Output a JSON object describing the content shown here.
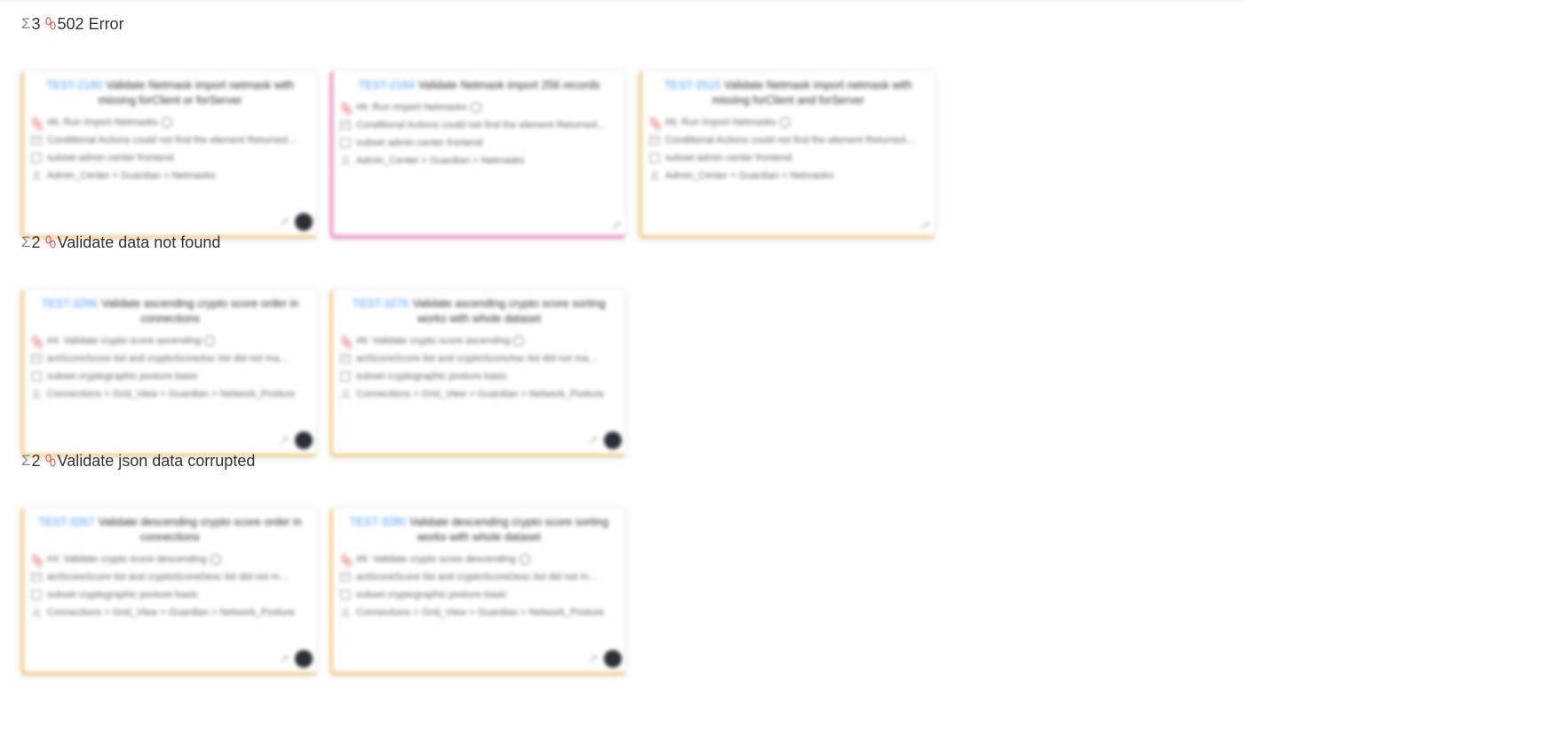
{
  "groups": [
    {
      "count": "3",
      "name": "502 Error",
      "cards": [
        {
          "id": "TEST-2180",
          "title": "Validate Netmask import netmask with missing forClient or forServer",
          "step": "#6: Run Import Netmasks",
          "error": "Conditional Actions could not find the element Returned…",
          "subset": "subset admin center frontend",
          "path": "Admin_Center > Guardian > Netmasks",
          "status": "failed",
          "github": true
        },
        {
          "id": "TEST-2184",
          "title": "Validate Netmask import 256 records",
          "step": "#6: Run Import Netmasks",
          "error": "Conditional Actions could not find the element Returned…",
          "subset": "subset admin center frontend",
          "path": "Admin_Center > Guardian > Netmasks",
          "status": "flaky",
          "github": false
        },
        {
          "id": "TEST-2515",
          "title": "Validate Netmask import netmask with missing forClient and forServer",
          "step": "#6: Run Import Netmasks",
          "error": "Conditional Actions could not find the element Returned…",
          "subset": "subset admin center frontend",
          "path": "Admin_Center > Guardian > Netmasks",
          "status": "failed",
          "github": false
        }
      ]
    },
    {
      "count": "2",
      "name": "Validate data not found",
      "cards": [
        {
          "id": "TEST-3266",
          "title": "Validate ascending crypto score order in connections",
          "step": "#4: Validate crypto score ascending",
          "error": "actScoreScore list and cryptoScoreAsc list did not ma…",
          "subset": "subset cryptographic posture basic",
          "path": "Connections > Grid_View > Guardian > Network_Posture",
          "status": "failed",
          "github": true
        },
        {
          "id": "TEST-3276",
          "title": "Validate ascending crypto score sorting works with whole dataset",
          "step": "#6: Validate crypto score ascending",
          "error": "actScoreScore list and cryptoScoreAsc list did not ma…",
          "subset": "subset cryptographic posture basic",
          "path": "Connections > Grid_View > Guardian > Network_Posture",
          "status": "failed",
          "github": true
        }
      ]
    },
    {
      "count": "2",
      "name": "Validate json data corrupted",
      "cards": [
        {
          "id": "TEST-3267",
          "title": "Validate descending crypto score order in connections",
          "step": "#4: Validate crypto score descending",
          "error": "actScoreScore list and cryptoScoreDesc list did not m…",
          "subset": "subset cryptographic posture basic",
          "path": "Connections > Grid_View > Guardian > Network_Posture",
          "status": "failed",
          "github": true
        },
        {
          "id": "TEST-3280",
          "title": "Validate descending crypto score sorting works with whole dataset",
          "step": "#6: Validate crypto score descending",
          "error": "actScoreScore list and cryptoScoreDesc list did not m…",
          "subset": "subset cryptographic posture basic",
          "path": "Connections > Grid_View > Guardian > Network_Posture",
          "status": "failed",
          "github": true
        }
      ]
    }
  ],
  "colors": {
    "failed_border": "#f5c978",
    "flaky_border": "#f07ab8",
    "test_id": "#4a9fff",
    "bug_icon": "#e05a5a"
  },
  "icons": {
    "group_sigma": "sigma-icon",
    "group_bug": "bug-icon",
    "card_step": "bug-icon",
    "card_error": "message-icon",
    "card_subset": "checkbox-icon",
    "card_path": "user-icon",
    "card_footer_pin": "pin-icon",
    "card_footer_github": "github-icon"
  }
}
